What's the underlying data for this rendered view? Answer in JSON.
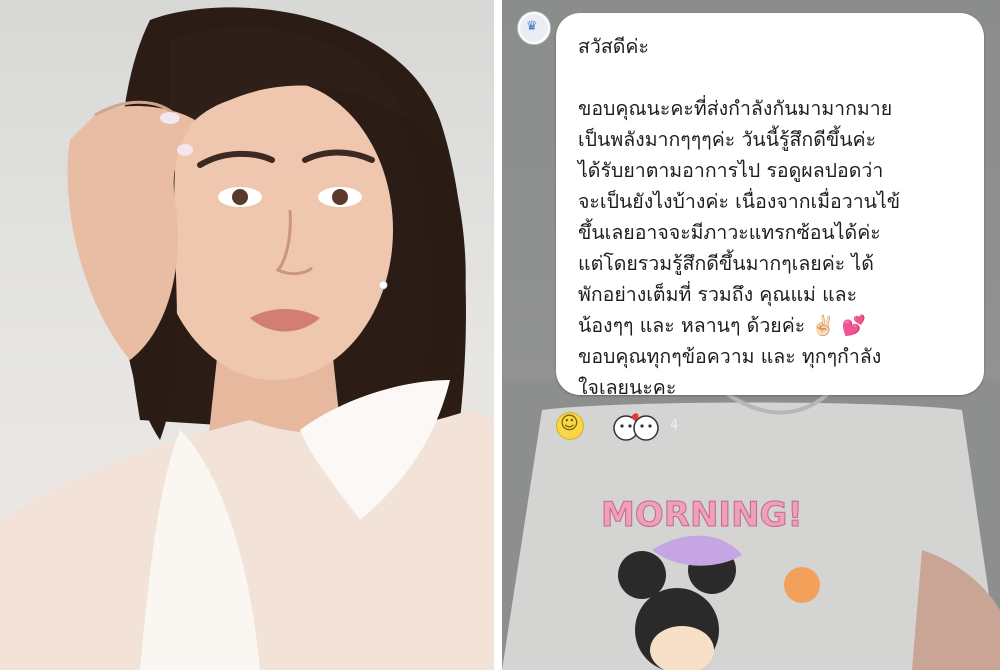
{
  "chat": {
    "greeting": "สวัสดีค่ะ",
    "message_lines": [
      "ขอบคุณนะคะที่ส่งกำลังกันมามากมาย",
      "เป็นพลังมากๆๆๆค่ะ  วันนี้รู้สึกดีขึ้นค่ะ",
      "ได้รับยาตามอาการไป  รอดูผลปอดว่า",
      "จะเป็นยังไงบ้างค่ะ เนื่องจากเมื่อวานไข้",
      "ขึ้นเลยอาจจะมีภาวะแทรกซ้อนได้ค่ะ",
      "แต่โดยรวมรู้สึกดีขึ้นมากๆเลยค่ะ ได้",
      "พักอย่างเต็มที่ รวมถึง คุณแม่ และ",
      "น้องๆๆ และ หลานๆ ด้วยค่ะ ✌🏻 💕",
      "ขอบคุณทุกๆข้อความ และ ทุกๆกำลัง",
      "ใจเลยนะคะ"
    ]
  },
  "reactions": {
    "smile_icon": "smiley-face-icon",
    "sticker_icon": "kissing-faces-sticker-icon",
    "count": "4"
  },
  "background_shirt_text": "MORNING!",
  "colors": {
    "bubble": "#ffffff",
    "chat_background": "#8f9190",
    "shirt_text_pink": "#f0a0b8"
  }
}
